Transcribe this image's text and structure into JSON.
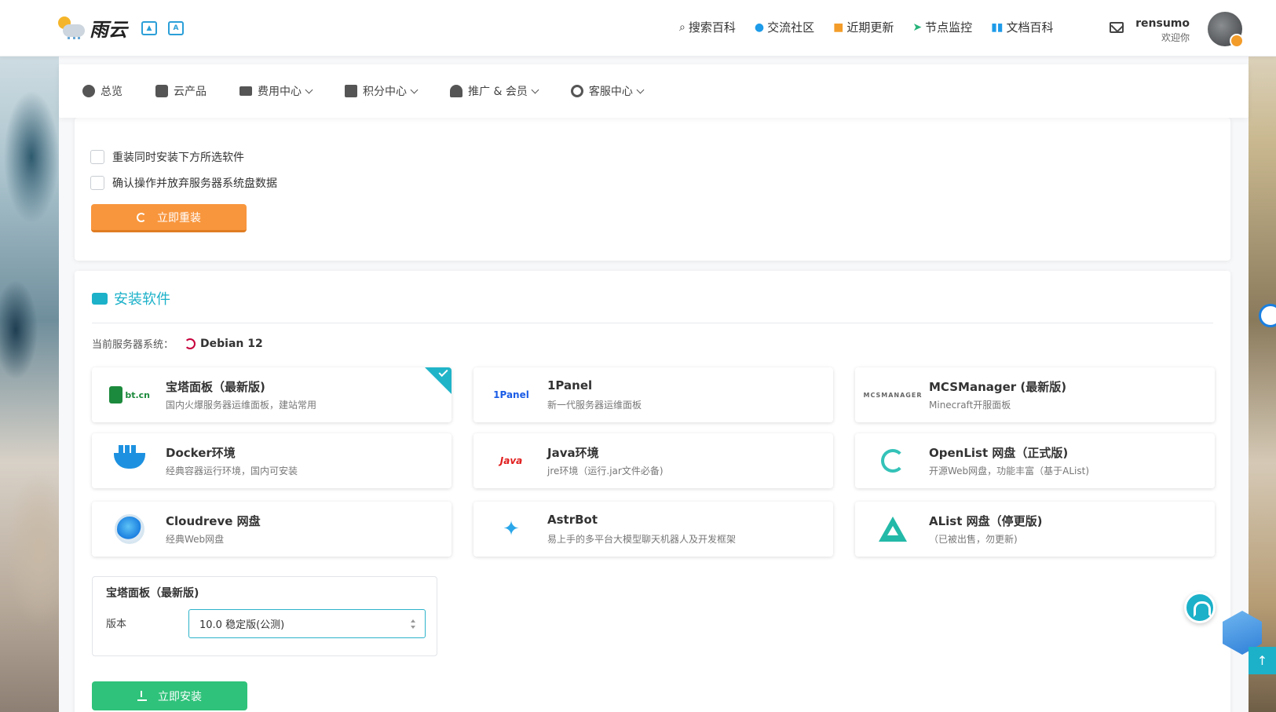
{
  "header": {
    "logo_text": "雨云",
    "nav": [
      {
        "icon": "search-icon",
        "label": "搜索百科"
      },
      {
        "icon": "qq-icon",
        "label": "交流社区"
      },
      {
        "icon": "news-icon",
        "label": "近期更新"
      },
      {
        "icon": "send-icon",
        "label": "节点监控"
      },
      {
        "icon": "book-icon",
        "label": "文档百科"
      }
    ],
    "user": {
      "name": "rensumo",
      "welcome": "欢迎你"
    }
  },
  "subnav": [
    {
      "label": "总览",
      "has_caret": false
    },
    {
      "label": "云产品",
      "has_caret": false
    },
    {
      "label": "费用中心",
      "has_caret": true
    },
    {
      "label": "积分中心",
      "has_caret": true
    },
    {
      "label": "推广 & 会员",
      "has_caret": true
    },
    {
      "label": "客服中心",
      "has_caret": true
    }
  ],
  "reinstall": {
    "check1": "重装同时安装下方所选软件",
    "check2": "确认操作并放弃服务器系统盘数据",
    "button": "立即重装"
  },
  "software": {
    "title": "安装软件",
    "os_label": "当前服务器系统：",
    "os_value": "Debian 12",
    "apps": [
      {
        "name": "宝塔面板（最新版)",
        "desc": "国内火爆服务器运维面板，建站常用",
        "logo": "bt.cn",
        "selected": true
      },
      {
        "name": "1Panel",
        "desc": "新一代服务器运维面板",
        "logo": "1Panel",
        "selected": false
      },
      {
        "name": "MCSManager (最新版)",
        "desc": "Minecraft开服面板",
        "logo": "MCSMANAGER",
        "selected": false
      },
      {
        "name": "Docker环境",
        "desc": "经典容器运行环境，国内可安装",
        "logo": "",
        "selected": false
      },
      {
        "name": "Java环境",
        "desc": "jre环境（运行.jar文件必备)",
        "logo": "Java",
        "selected": false
      },
      {
        "name": "OpenList 网盘（正式版)",
        "desc": "开源Web网盘，功能丰富（基于AList)",
        "logo": "",
        "selected": false
      },
      {
        "name": "Cloudreve 网盘",
        "desc": "经典Web网盘",
        "logo": "",
        "selected": false
      },
      {
        "name": "AstrBot",
        "desc": "易上手的多平台大模型聊天机器人及开发框架",
        "logo": "✦",
        "selected": false
      },
      {
        "name": "AList 网盘（停更版)",
        "desc": "（已被出售，勿更新)",
        "logo": "",
        "selected": false
      }
    ],
    "version_panel": {
      "title": "宝塔面板（最新版)",
      "label": "版本",
      "selected_value": "10.0 稳定版(公测)"
    },
    "install_button": "立即安装"
  },
  "colors": {
    "accent": "#1cb1c9",
    "orange": "#f8963d",
    "green": "#2fc27a"
  }
}
